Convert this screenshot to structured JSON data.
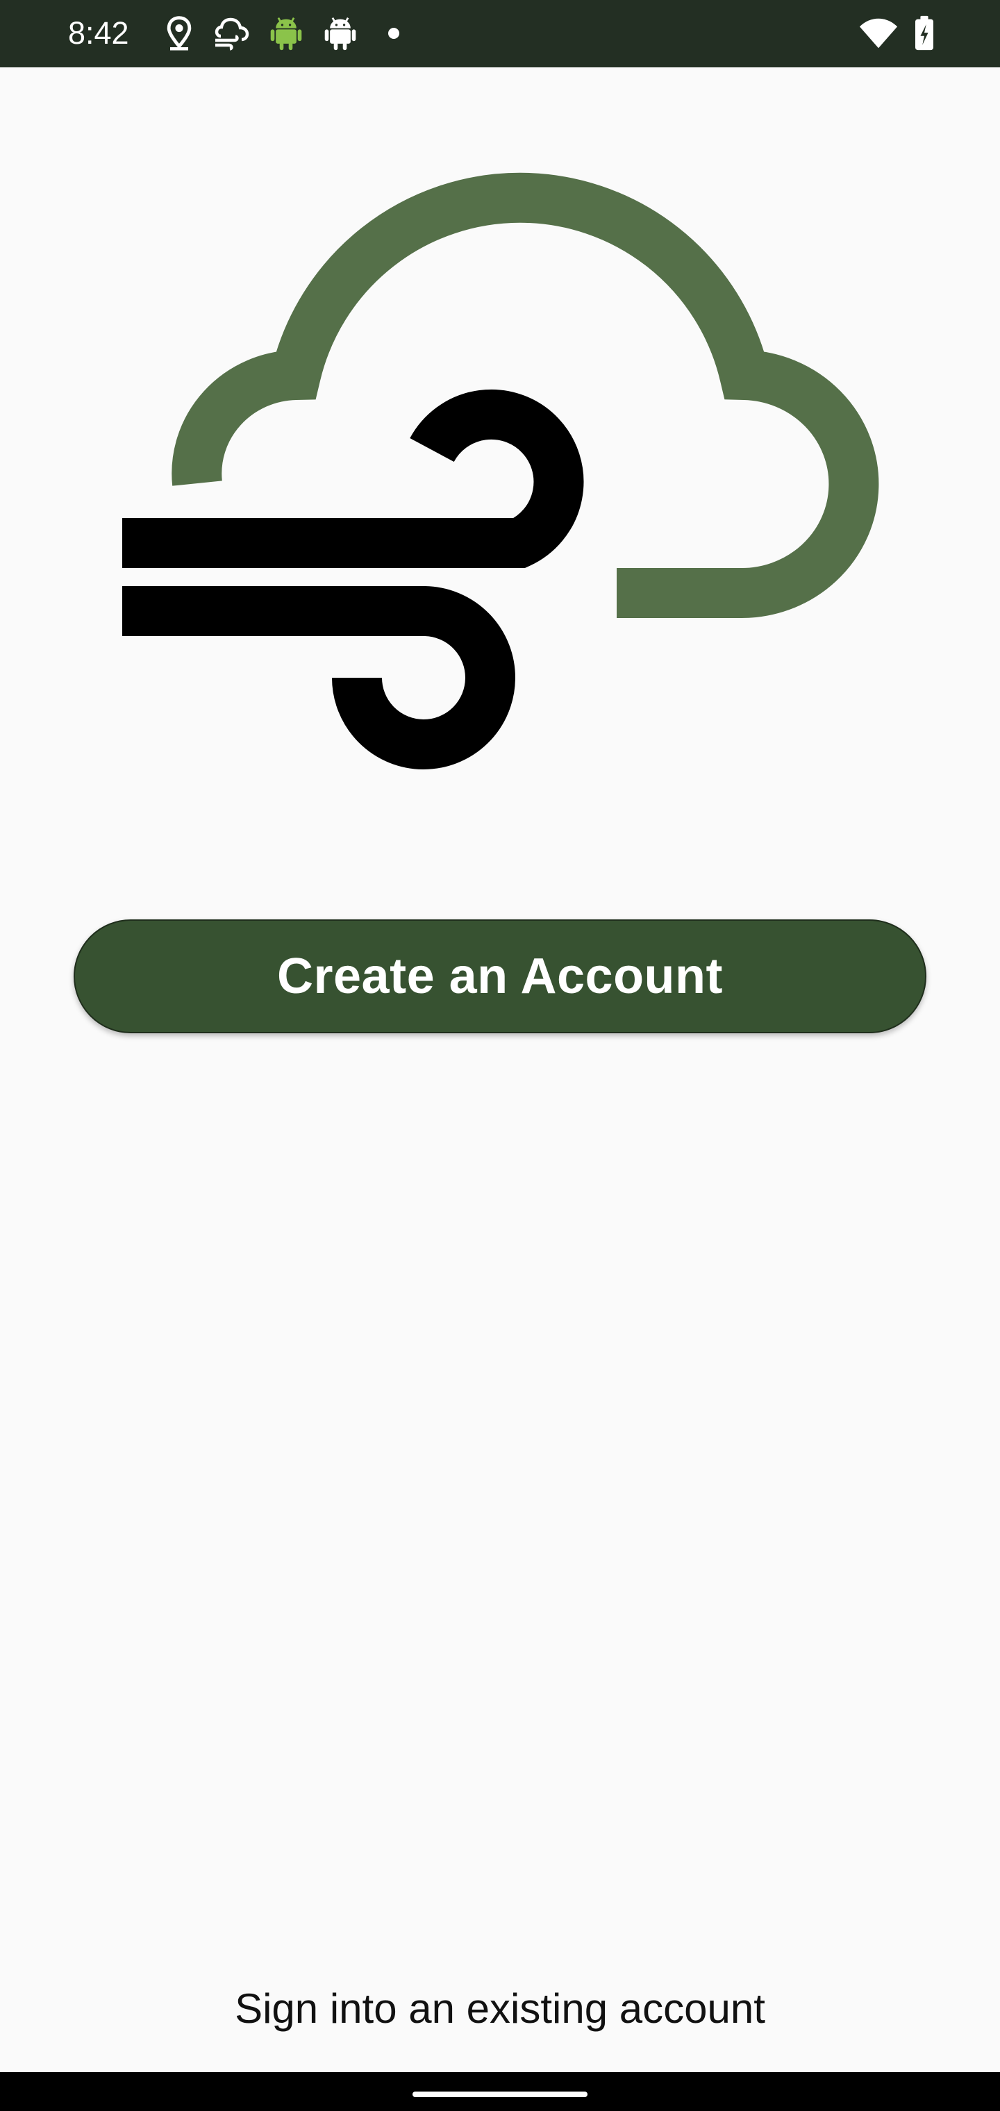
{
  "status_bar": {
    "time": "8:42",
    "background": "#232f23",
    "icons": [
      "location-icon",
      "cloud-wind-icon",
      "android-green-icon",
      "android-white-icon",
      "notification-dot-icon",
      "wifi-icon",
      "battery-charging-icon"
    ]
  },
  "logo": {
    "icon": "cloud-wind-logo-icon",
    "cloud_color": "#557049",
    "wind_color": "#000000"
  },
  "actions": {
    "create_account_label": "Create an Account",
    "create_account_color": "#375231",
    "sign_in_label": "Sign into an existing account"
  },
  "nav_bar": {
    "icon": "home-handle-icon"
  }
}
